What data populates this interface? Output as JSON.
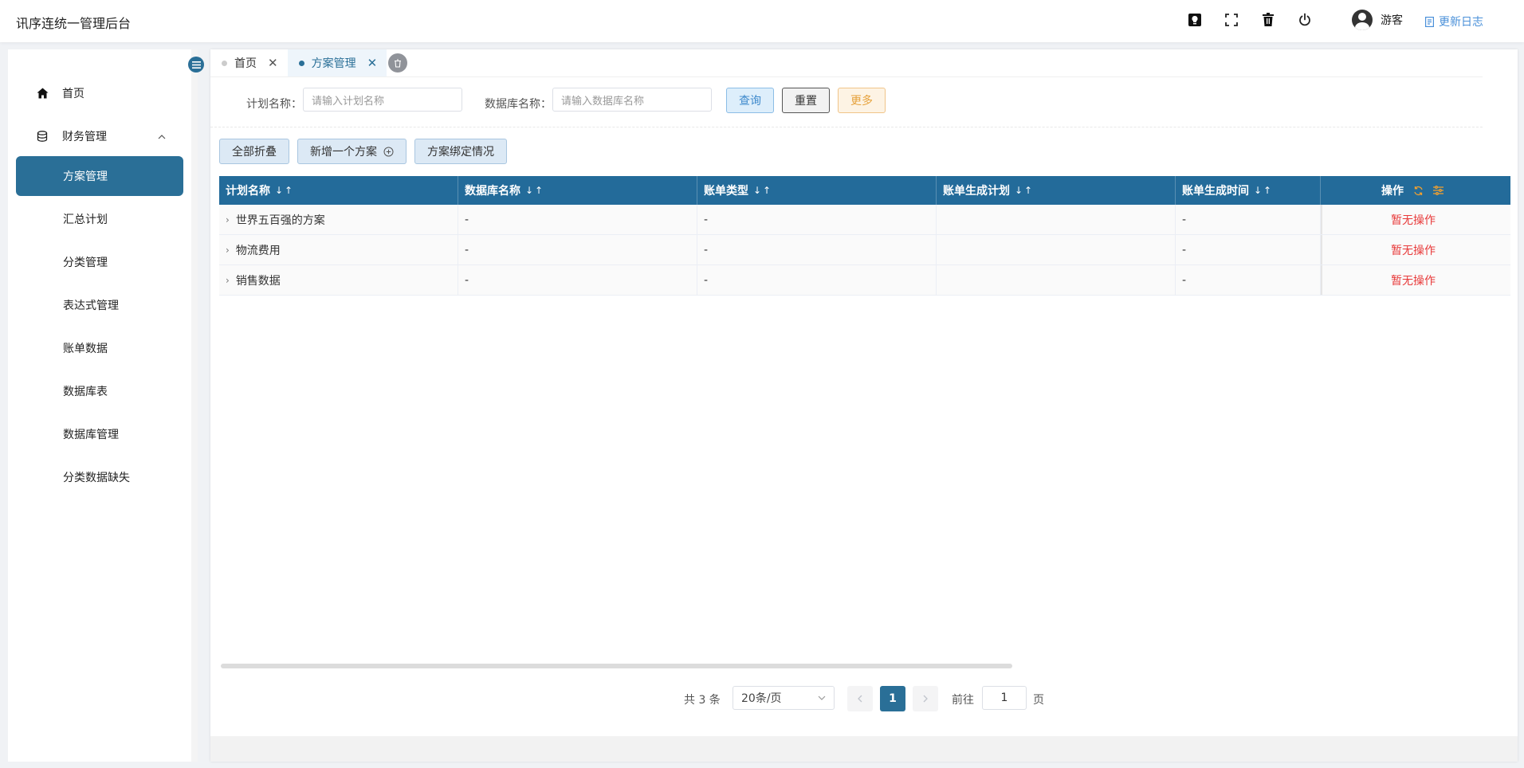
{
  "app": {
    "title": "讯序连统一管理后台"
  },
  "header": {
    "username": "游客",
    "changelog": "更新日志"
  },
  "sidebar": {
    "items": [
      {
        "label": "首页"
      },
      {
        "label": "财务管理"
      },
      {
        "label": "方案管理"
      },
      {
        "label": "汇总计划"
      },
      {
        "label": "分类管理"
      },
      {
        "label": "表达式管理"
      },
      {
        "label": "账单数据"
      },
      {
        "label": "数据库表"
      },
      {
        "label": "数据库管理"
      },
      {
        "label": "分类数据缺失"
      }
    ]
  },
  "tabs": [
    {
      "label": "首页"
    },
    {
      "label": "方案管理"
    }
  ],
  "filters": {
    "plan_label": "计划名称：",
    "plan_placeholder": "请输入计划名称",
    "db_label": "数据库名称：",
    "db_placeholder": "请输入数据库名称",
    "query": "查询",
    "reset": "重置",
    "more": "更多"
  },
  "actions": {
    "collapse_all": "全部折叠",
    "add_plan": "新增一个方案",
    "binding": "方案绑定情况"
  },
  "table": {
    "sort_symbol": "↓↑",
    "columns": [
      "计划名称",
      "数据库名称",
      "账单类型",
      "账单生成计划",
      "账单生成时间",
      "操作"
    ],
    "rows": [
      {
        "name": "世界五百强的方案",
        "db": "-",
        "type": "-",
        "plan": "",
        "time": "-",
        "op": "暂无操作"
      },
      {
        "name": "物流费用",
        "db": "-",
        "type": "-",
        "plan": "",
        "time": "-",
        "op": "暂无操作"
      },
      {
        "name": "销售数据",
        "db": "-",
        "type": "-",
        "plan": "",
        "time": "-",
        "op": "暂无操作"
      }
    ]
  },
  "pagination": {
    "total": "共 3 条",
    "page_size": "20条/页",
    "current": "1",
    "goto": "前往",
    "jump_value": "1",
    "unit": "页"
  }
}
